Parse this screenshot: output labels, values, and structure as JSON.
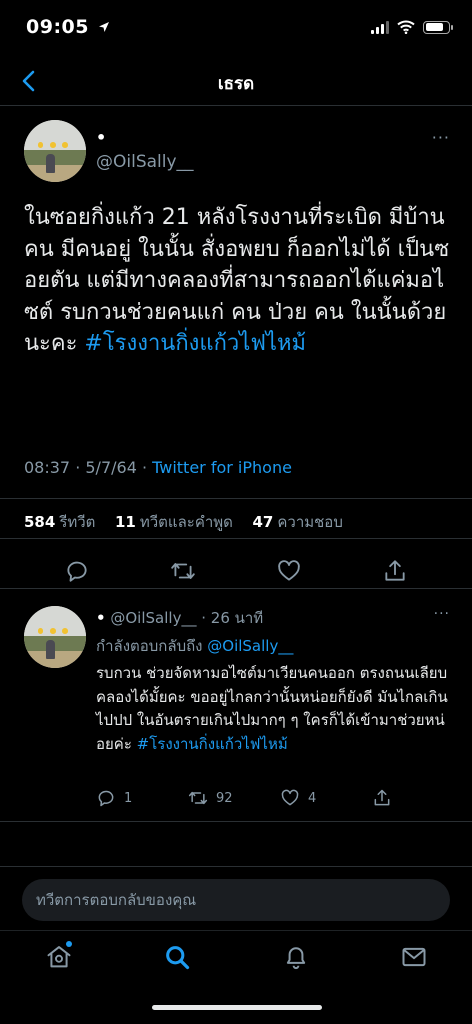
{
  "status_bar": {
    "time": "09:05"
  },
  "nav": {
    "title": "เธรด"
  },
  "main_tweet": {
    "name": "•",
    "handle": "@OilSally__",
    "more": "···",
    "text": "ในซอยกิ่งแก้ว 21 หลังโรงงานที่ระเบิด มีบ้านคน มีคนอยู่ ในนั้น สั่งอพยบ ก็ออกไม่ได้ เป็นซอยตัน แต่มีทางคลองที่สามารถออกได้แค่มอไซต์ รบกวนช่วยคนแก่ คน ป่วย คน ในนั้นด้วยนะคะ ",
    "hashtag": "#โรงงานกิ่งแก้วไฟไหม้",
    "time": "08:37 · 5/7/64 · ",
    "source": "Twitter for iPhone",
    "retweets_count": "584",
    "retweets_label": "รีทวีต",
    "quotes_count": "11",
    "quotes_label": "ทวีตและคำพูด",
    "likes_count": "47",
    "likes_label": "ความชอบ"
  },
  "reply": {
    "name": "•",
    "handle": "@OilSally__",
    "time": "· 26 นาที",
    "more": "···",
    "replying_to_label": "กำลังตอบกลับถึง ",
    "replying_to_handle": "@OilSally__",
    "text": "รบกวน ช่วยจัดหามอไซต์มาเวียนคนออก ตรงถนนเลียบคลองได้มั้ยคะ ขออยู่ไกลกว่านั้นหน่อยก็ยังดี มันไกลเกินไปปป ในอันตรายเกินไปมากๆ ๆ ใครก็ได้เข้ามาช่วยหน่อยค่ะ ",
    "hashtag": "#โรงงานกิ่งแก้วไฟไหม้",
    "reply_count": "1",
    "retweet_count": "92",
    "like_count": "4"
  },
  "composer": {
    "placeholder": "ทวีตการตอบกลับของคุณ"
  },
  "colors": {
    "background": "#000000",
    "accent": "#1d9bf0",
    "secondary_text": "#8899a6",
    "divider": "#2a2f33"
  }
}
